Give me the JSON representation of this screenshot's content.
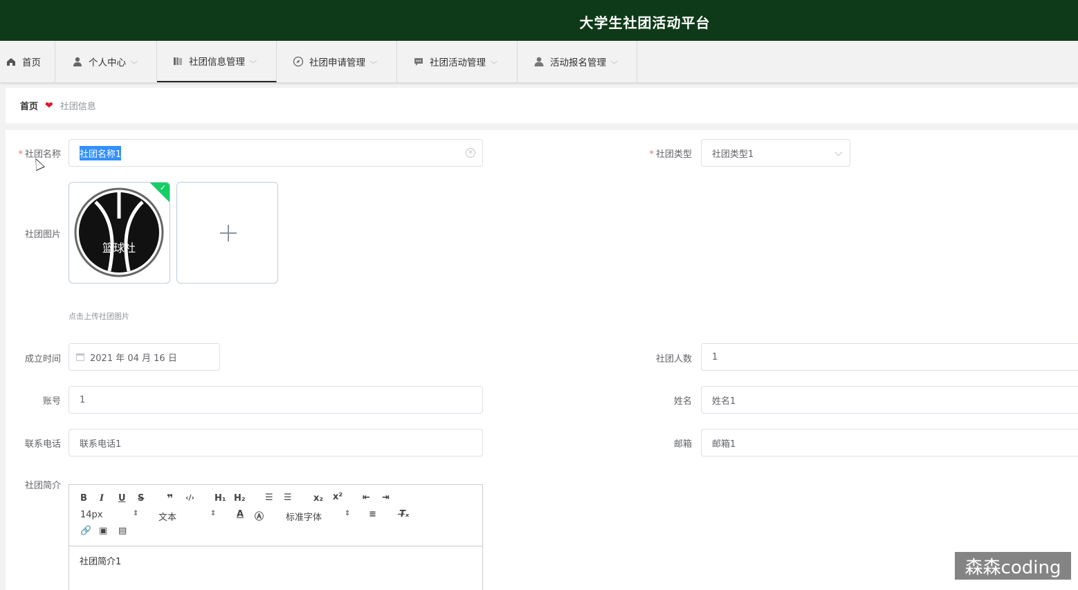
{
  "app": {
    "title": "大学生社团活动平台"
  },
  "nav": {
    "items": [
      {
        "label": "首页",
        "icon": "home-icon",
        "has_menu": false
      },
      {
        "label": "个人中心",
        "icon": "user-icon",
        "has_menu": true
      },
      {
        "label": "社团信息管理",
        "icon": "book-icon",
        "has_menu": true,
        "active": true
      },
      {
        "label": "社团申请管理",
        "icon": "compass-icon",
        "has_menu": true
      },
      {
        "label": "社团活动管理",
        "icon": "chat-icon",
        "has_menu": true
      },
      {
        "label": "活动报名管理",
        "icon": "user-solid-icon",
        "has_menu": true
      }
    ]
  },
  "breadcrumb": {
    "home": "首页",
    "current": "社团信息"
  },
  "form": {
    "club_name": {
      "label": "社团名称",
      "value": "社团名称1"
    },
    "club_type": {
      "label": "社团类型",
      "value": "社团类型1"
    },
    "club_image": {
      "label": "社团图片",
      "hint": "点击上传社团图片",
      "logo_text": "篮球社"
    },
    "founded": {
      "label": "成立时间",
      "value": "2021 年 04 月 16 日"
    },
    "member_count": {
      "label": "社团人数",
      "value": "1"
    },
    "account": {
      "label": "账号",
      "value": "1"
    },
    "name": {
      "label": "姓名",
      "value": "姓名1"
    },
    "phone": {
      "label": "联系电话",
      "value": "联系电话1"
    },
    "email": {
      "label": "邮箱",
      "value": "邮箱1"
    },
    "intro": {
      "label": "社团简介",
      "value": "社团简介1"
    }
  },
  "editor": {
    "font_size": "14px",
    "block_type": "文本",
    "font_family": "标准字体"
  },
  "watermark": "森森coding",
  "colors": {
    "topbar": "#0f3a19",
    "required": "#f56c6c",
    "success": "#13ce66"
  }
}
